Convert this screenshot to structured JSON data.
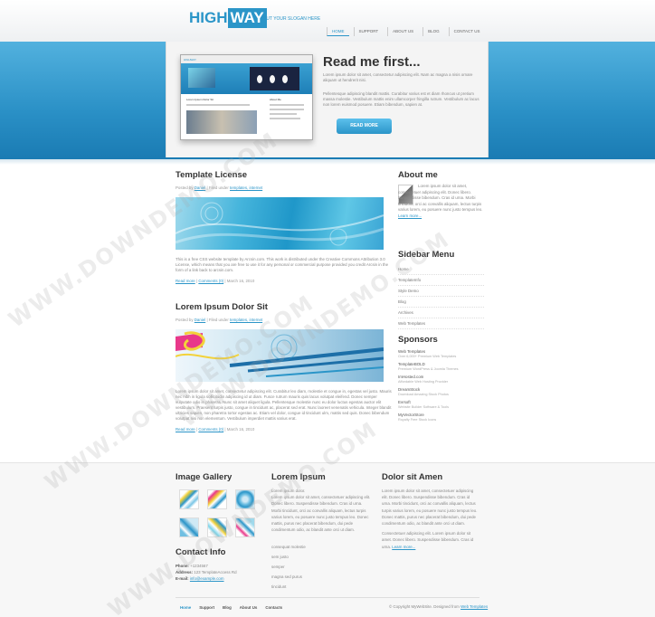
{
  "header": {
    "logo_high": "HIGH",
    "logo_way": "WAY",
    "slogan": "PUT YOUR SLOGAN HERE",
    "nav": [
      {
        "label": "HOME",
        "active": true
      },
      {
        "label": "SUPPORT",
        "active": false
      },
      {
        "label": "ABOUT US",
        "active": false
      },
      {
        "label": "BLOG",
        "active": false
      },
      {
        "label": "CONTACT US",
        "active": false
      }
    ]
  },
  "hero": {
    "title": "Read me first...",
    "para1": "Lorem ipsum dolor sit amet, consectetur adipiscing elit. Nam ac magna a nisis ornare aliquam ut hendrerit nisi.",
    "para2": "Pellentesque adipiscing blandit mattis. Curabitur varius est et diam rhoncus ut pretium massa molestie. Vestibulum mattis enim ullamcorper fringilla rutrum. Vestibulum ac lacus non lorem euismod posuere. Etiam bibendum, sapien at.",
    "button": "READ MORE",
    "preview": {
      "logo": "HIGHWAY",
      "post_title": "Lorem Ipsum Dolor Sit",
      "side_title": "About Me"
    }
  },
  "posts": [
    {
      "title": "Template License",
      "meta_prefix": "Posted by",
      "author": "Daniel",
      "meta_middle": "| Filed under",
      "tags": "templates, internet",
      "body": "This is a free CSS website template by Arcsin.com. This work is distributed under the Creative Commons Attribution 3.0 License, which means that you are free to use it for any personal or commercial purpose provided you credit Arcsin in the form of a link back to arcsin.com.",
      "link_readmore": "Read more",
      "link_comments": "Comments (0)",
      "date": "| March 16, 2010"
    },
    {
      "title": "Lorem Ipsum Dolor Sit",
      "meta_prefix": "Posted by",
      "author": "Daniel",
      "meta_middle": "| Filed under",
      "tags": "templates, internet",
      "body": "Lorem ipsum dolor sit amet, consectetur adipiscing elit. Curabitur leo diam, molestie et congue in, egestas vel justo. Mauris nec nibh in ligula sollicitudin adipiscing id ut diam. Fusce rutrum mauris quis lacus volutpat eleifend. Donec semper vulputate odio in pharetra. Nunc sit amet aliquet ligula. Pellentesque molestie nunc eu dolor luctus egestas auctor elit vestibulum. Praesent turpis justo, congue in tincidunt ac, placerat sed erat. Nunc laoreet venenatis vehicula. Integer blandit ultricies sapien, non pharetra tortor egestas ac. Etiam vel dolor, congue id tincidunt ulm, mattis sed quis. Donec bibendum volutpat nisi non elementum. Vestibulum imperdiet mattis varius erat.",
      "link_readmore": "Read more",
      "link_comments": "Comments (0)",
      "date": "| March 16, 2010"
    }
  ],
  "sidebar": {
    "about_title": "About me",
    "about_text": "Lorem ipsum dolor sit amet, consectetuer adipiscing elit. Donec libero. Suspendisse bibendum. Cras id urna. Morbi tincidunt, orci ac convallis aliquam, lectus turpis varius lorem, eu posuere nunc justo tempus leo.",
    "about_link": "Learn more...",
    "menu_title": "Sidebar Menu",
    "menu": [
      "Home",
      "TemplateInfo",
      "Style Demo",
      "Blog",
      "Archives",
      "Web Templates"
    ],
    "sponsors_title": "Sponsors",
    "sponsors": [
      {
        "name": "Web Templates",
        "desc": "Over 6,000+ Premium Web Templates"
      },
      {
        "name": "TemplateBOLD",
        "desc": "Premium WordPress & Joomla Themes"
      },
      {
        "name": "ImHosted.com",
        "desc": "Affordable Web Hosting Provider"
      },
      {
        "name": "DreamStock",
        "desc": "Download Amazing Stock Photos"
      },
      {
        "name": "Evrsoft",
        "desc": "Website Builder Software & Tools"
      },
      {
        "name": "MyVectorStore",
        "desc": "Royalty Free Stock Icons"
      }
    ]
  },
  "bottom": {
    "gallery_title": "Image Gallery",
    "contact_title": "Contact Info",
    "contact_phone_label": "Phone:",
    "contact_phone": "+1234567",
    "contact_address_label": "Address:",
    "contact_address": "123 TemplateAccess Rd",
    "contact_email_label": "E-mail:",
    "contact_email": "info@example.com",
    "col2_title": "Lorem Ipsum",
    "col2_line1": "Lorem ipsum dolor.",
    "col2_text": "Lorem ipsum dolor sit amet, consectetuer adipiscing elit. Donec libero. Suspendisse bibendum. Cras id urna. Morbi tincidunt, orci ac convallis aliquam, lectus turpis varius lorem, eu posuere nunc justo tempus leo. Donec mattis, purus nec placerat bibendum, dui pede condimentum odio, ac blandit ante orci ut diam.",
    "col2_links": [
      "consequat molestie",
      "sem justo",
      "semper",
      "magna sed purus",
      "tincidunt"
    ],
    "col3_title": "Dolor sit Amen",
    "col3_text1": "Lorem ipsum dolor sit amet, consectetuer adipiscing elit. Donec libero. Suspendisse bibendum. Cras id urna. Morbi tincidunt, orci ac convallis aliquam, lectus turpis varius lorem, eu posuere nunc justo tempus leo. Donec mattis, purus nec placerat bibendum, dui pede condimentum odio, ac blandit ante orci ut diam.",
    "col3_text2": "Consectetuer adipiscing elit. Lorem ipsum dolor sit amet. Donec libero. Suspendisse bibendum. Cras id urna.",
    "col3_link": "Learn more...",
    "footer_nav": [
      {
        "label": "Home",
        "active": true
      },
      {
        "label": "Support",
        "active": false
      },
      {
        "label": "Blog",
        "active": false
      },
      {
        "label": "About Us",
        "active": false
      },
      {
        "label": "Contacts",
        "active": false
      }
    ],
    "copyright_prefix": "© Copyright MyWebSite. Designed from",
    "copyright_link": "Web Templates"
  },
  "watermark": "WWW.DOWNDEMO.COM",
  "colors": {
    "brand": "#2b95c8",
    "band": "#2a90c6"
  }
}
